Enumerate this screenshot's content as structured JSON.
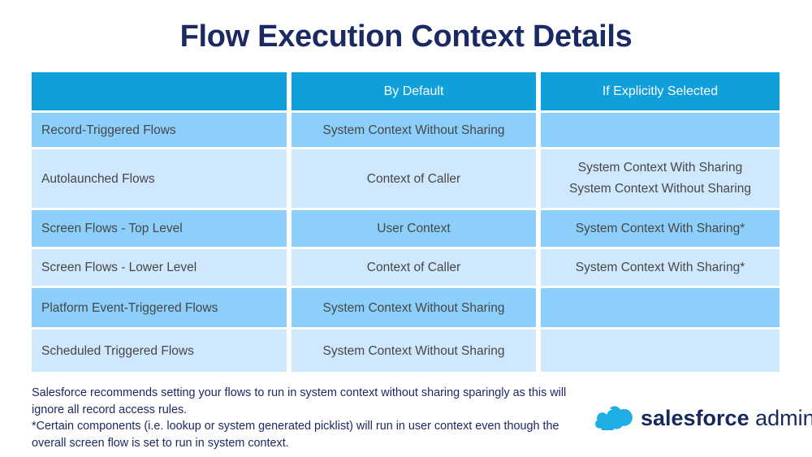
{
  "page": {
    "title": "Flow Execution Context Details",
    "colors": {
      "title_navy": "#1b2a63",
      "header_blue": "#0f9fda",
      "row_dark_blue": "#8bcffa",
      "row_light_blue": "#cfe8fd",
      "cell_text": "#474747",
      "footnote_navy": "#1b2a63",
      "logo_cloud_blue": "#1eaee6",
      "logo_text_navy": "#16295c"
    }
  },
  "table": {
    "columns": [
      "",
      "By Default",
      "If Explicitly Selected"
    ],
    "rows": [
      {
        "name": "Record-Triggered Flows",
        "by_default": "System Context Without Sharing",
        "if_explicit": ""
      },
      {
        "name": "Autolaunched Flows",
        "by_default": "Context of Caller",
        "if_explicit_lines": [
          "System Context With Sharing",
          "System Context Without Sharing"
        ]
      },
      {
        "name": "Screen Flows - Top Level",
        "by_default": "User Context",
        "if_explicit": "System Context With Sharing*"
      },
      {
        "name": "Screen Flows - Lower Level",
        "by_default": "Context of Caller",
        "if_explicit": "System Context With Sharing*"
      },
      {
        "name": "Platform Event-Triggered Flows",
        "by_default": "System Context Without Sharing",
        "if_explicit": ""
      },
      {
        "name": "Scheduled Triggered Flows",
        "by_default": "System Context Without Sharing",
        "if_explicit": ""
      }
    ]
  },
  "footnote": {
    "line1": "Salesforce recommends setting your flows to run in system context without sharing sparingly as this will ignore all record access rules.",
    "line2": "*Certain components (i.e. lookup or system generated picklist) will run in user context even though the overall screen flow is set to run in system context."
  },
  "logo": {
    "icon": "salesforce-cloud-icon",
    "brand": "salesforce",
    "product": "admins"
  }
}
